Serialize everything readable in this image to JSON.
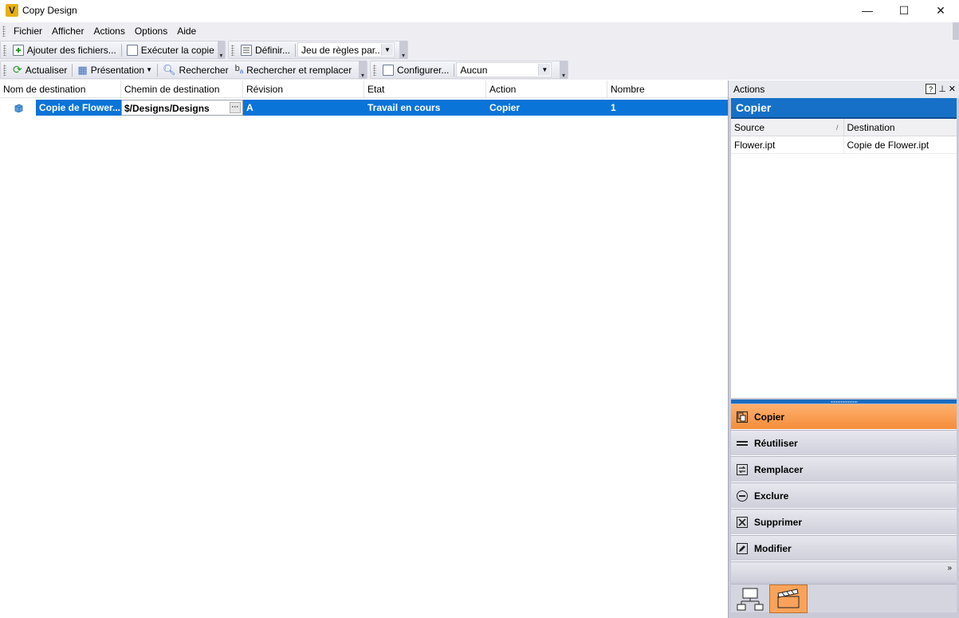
{
  "window": {
    "title": "Copy Design",
    "app_icon_letter": "V",
    "controls": {
      "minimize": "—",
      "maximize": "☐",
      "close": "✕"
    }
  },
  "menu": {
    "items": [
      "Fichier",
      "Afficher",
      "Actions",
      "Options",
      "Aide"
    ]
  },
  "toolbar1": {
    "add_files": "Ajouter des fichiers...",
    "run_copy": "Exécuter la copie",
    "define": "Définir...",
    "ruleset_value": "Jeu de règles par..."
  },
  "toolbar2": {
    "refresh": "Actualiser",
    "presentation": "Présentation",
    "search": "Rechercher",
    "search_replace": "Rechercher et remplacer",
    "configure": "Configurer...",
    "filter_value": "Aucun"
  },
  "grid": {
    "columns": [
      "Nom de destination",
      "Chemin de destination",
      "Révision",
      "Etat",
      "Action",
      "Nombre"
    ],
    "rows": [
      {
        "name": "Copie de Flower...",
        "path": "$/Designs/Designs",
        "revision": "A",
        "state": "Travail en cours",
        "action": "Copier",
        "count": "1"
      }
    ]
  },
  "actions_panel": {
    "title": "Actions",
    "header": "Copier",
    "table_columns": [
      "Source",
      "Destination"
    ],
    "table_rows": [
      {
        "source": "Flower.ipt",
        "destination": "Copie de Flower.ipt"
      }
    ],
    "buttons": [
      {
        "label": "Copier",
        "icon": "copy-icon",
        "active": true
      },
      {
        "label": "Réutiliser",
        "icon": "equals-icon",
        "active": false
      },
      {
        "label": "Remplacer",
        "icon": "replace-icon",
        "active": false
      },
      {
        "label": "Exclure",
        "icon": "minus-circle-icon",
        "active": false
      },
      {
        "label": "Supprimer",
        "icon": "x-box-icon",
        "active": false
      },
      {
        "label": "Modifier",
        "icon": "edit-icon",
        "active": false
      }
    ]
  },
  "colors": {
    "selection": "#0a74d8",
    "panel_header": "#1670c8",
    "active_action": "#f48d3b"
  }
}
